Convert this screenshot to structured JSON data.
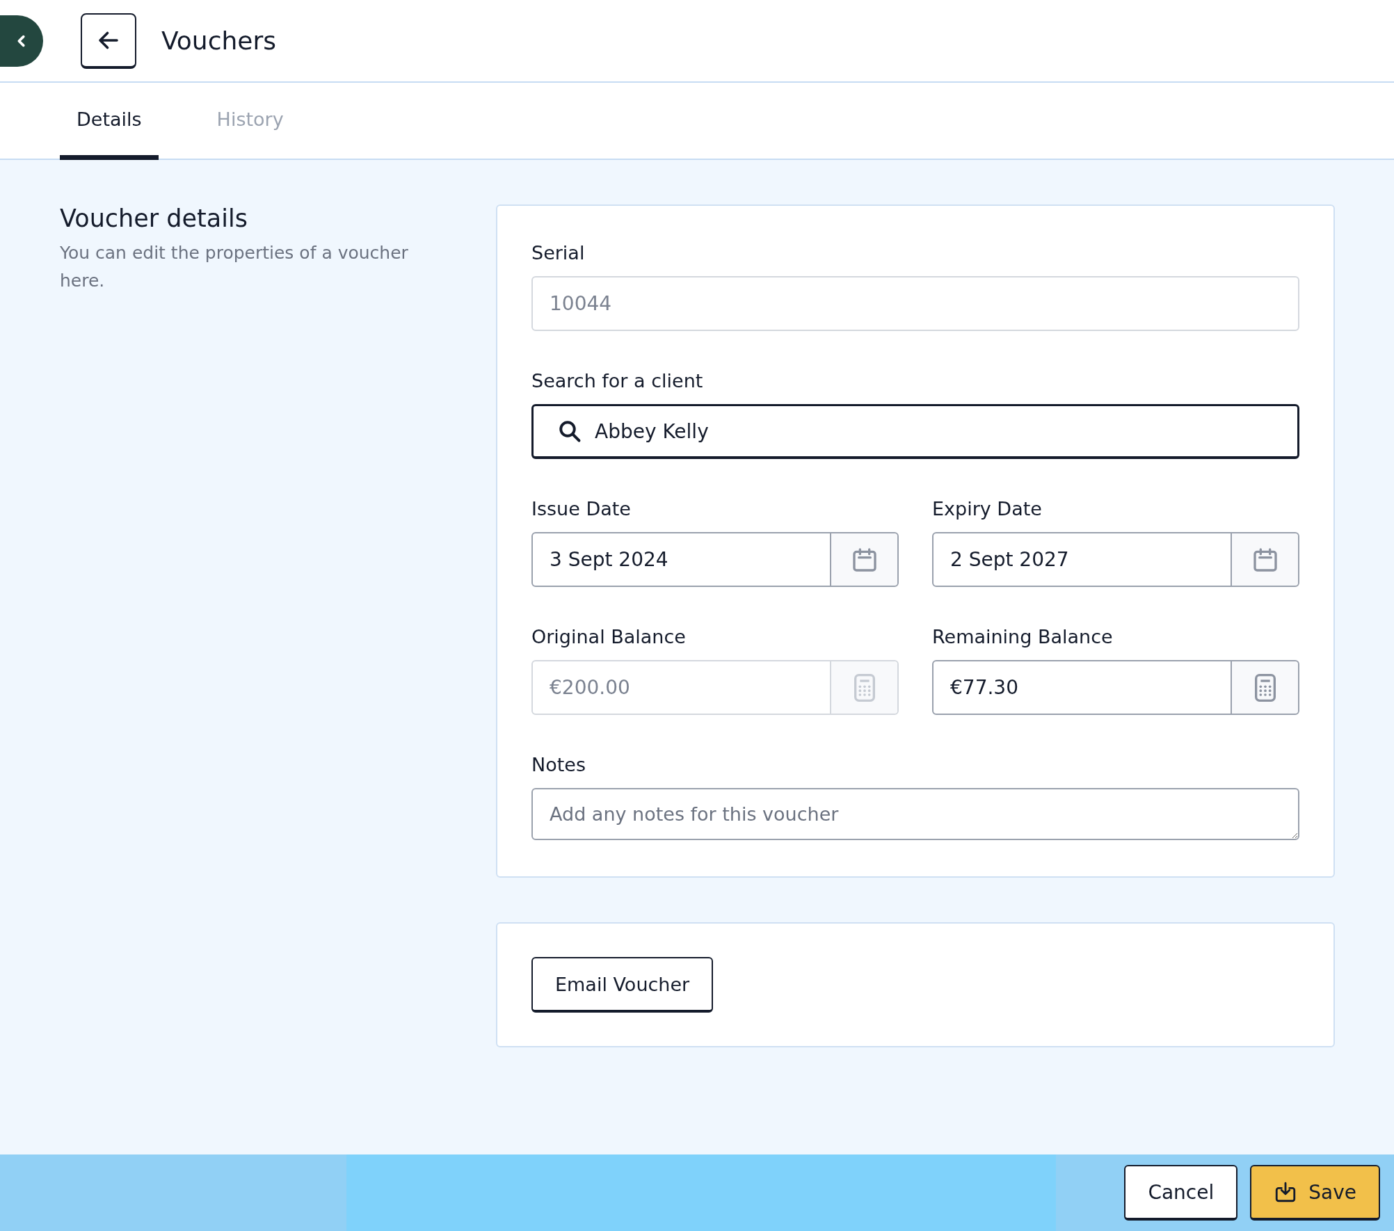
{
  "header": {
    "title": "Vouchers"
  },
  "tabs": [
    {
      "label": "Details",
      "selected": true
    },
    {
      "label": "History",
      "selected": false
    }
  ],
  "section": {
    "title": "Voucher details",
    "description": "You can edit the properties of a voucher here."
  },
  "form_rows": [
    [
      {
        "kind": "text",
        "label": "Serial",
        "value": "10044",
        "disabled": true
      }
    ],
    [
      {
        "kind": "search",
        "label": "Search for a client",
        "value": "Abbey Kelly",
        "disabled": false,
        "focused": true
      }
    ],
    [
      {
        "kind": "date",
        "label": "Issue Date",
        "value": "3 Sept 2024",
        "disabled": false
      },
      {
        "kind": "date",
        "label": "Expiry Date",
        "value": "2 Sept 2027",
        "disabled": false
      }
    ],
    [
      {
        "kind": "amount",
        "label": "Original Balance",
        "value": "€200.00",
        "disabled": true
      },
      {
        "kind": "amount",
        "label": "Remaining Balance",
        "value": "€77.30",
        "disabled": false
      }
    ],
    [
      {
        "kind": "textarea",
        "label": "Notes",
        "placeholder": "Add any notes for this voucher"
      }
    ]
  ],
  "actions_card": {
    "buttons": [
      "Email Voucher"
    ]
  },
  "footer": {
    "buttons": [
      {
        "kind": "secondary",
        "label": "Cancel"
      },
      {
        "kind": "primary",
        "label": "Save"
      }
    ]
  }
}
